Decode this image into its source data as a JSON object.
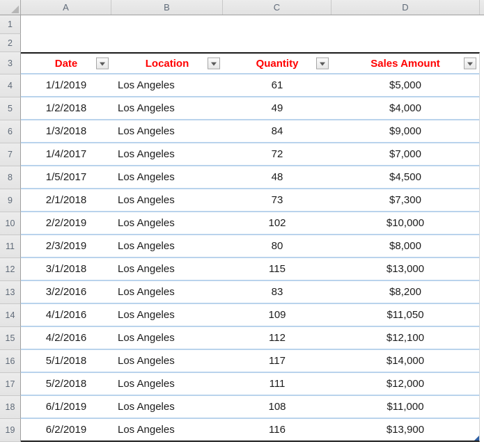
{
  "grid": {
    "column_headers": [
      "A",
      "B",
      "C",
      "D"
    ],
    "row_numbers": [
      "1",
      "2",
      "3",
      "4",
      "5",
      "6",
      "7",
      "8",
      "9",
      "10",
      "11",
      "12",
      "13",
      "14",
      "15",
      "16",
      "17",
      "18",
      "19"
    ]
  },
  "table": {
    "headers": {
      "date": "Date",
      "location": "Location",
      "quantity": "Quantity",
      "sales": "Sales Amount"
    },
    "rows": [
      {
        "date": "1/1/2019",
        "location": "Los Angeles",
        "quantity": "61",
        "sales": "$5,000"
      },
      {
        "date": "1/2/2018",
        "location": "Los Angeles",
        "quantity": "49",
        "sales": "$4,000"
      },
      {
        "date": "1/3/2018",
        "location": "Los Angeles",
        "quantity": "84",
        "sales": "$9,000"
      },
      {
        "date": "1/4/2017",
        "location": "Los Angeles",
        "quantity": "72",
        "sales": "$7,000"
      },
      {
        "date": "1/5/2017",
        "location": "Los Angeles",
        "quantity": "48",
        "sales": "$4,500"
      },
      {
        "date": "2/1/2018",
        "location": "Los Angeles",
        "quantity": "73",
        "sales": "$7,300"
      },
      {
        "date": "2/2/2019",
        "location": "Los Angeles",
        "quantity": "102",
        "sales": "$10,000"
      },
      {
        "date": "2/3/2019",
        "location": "Los Angeles",
        "quantity": "80",
        "sales": "$8,000"
      },
      {
        "date": "3/1/2018",
        "location": "Los Angeles",
        "quantity": "115",
        "sales": "$13,000"
      },
      {
        "date": "3/2/2016",
        "location": "Los Angeles",
        "quantity": "83",
        "sales": "$8,200"
      },
      {
        "date": "4/1/2016",
        "location": "Los Angeles",
        "quantity": "109",
        "sales": "$11,050"
      },
      {
        "date": "4/2/2016",
        "location": "Los Angeles",
        "quantity": "112",
        "sales": "$12,100"
      },
      {
        "date": "5/1/2018",
        "location": "Los Angeles",
        "quantity": "117",
        "sales": "$14,000"
      },
      {
        "date": "5/2/2018",
        "location": "Los Angeles",
        "quantity": "111",
        "sales": "$12,000"
      },
      {
        "date": "6/1/2019",
        "location": "Los Angeles",
        "quantity": "108",
        "sales": "$11,000"
      },
      {
        "date": "6/2/2019",
        "location": "Los Angeles",
        "quantity": "116",
        "sales": "$13,900"
      }
    ]
  },
  "icons": {
    "filter_dropdown": "filter-dropdown-arrow",
    "select_all": "select-all-triangle",
    "resize_handle": "table-resize-handle"
  },
  "colors": {
    "header_text_red": "#FF0000",
    "row_separator_blue": "#B9D3EC",
    "table_border_black": "#1A1A1A",
    "resize_handle_blue": "#2E5FA3",
    "header_fill_gray": "#E8E8E8"
  }
}
